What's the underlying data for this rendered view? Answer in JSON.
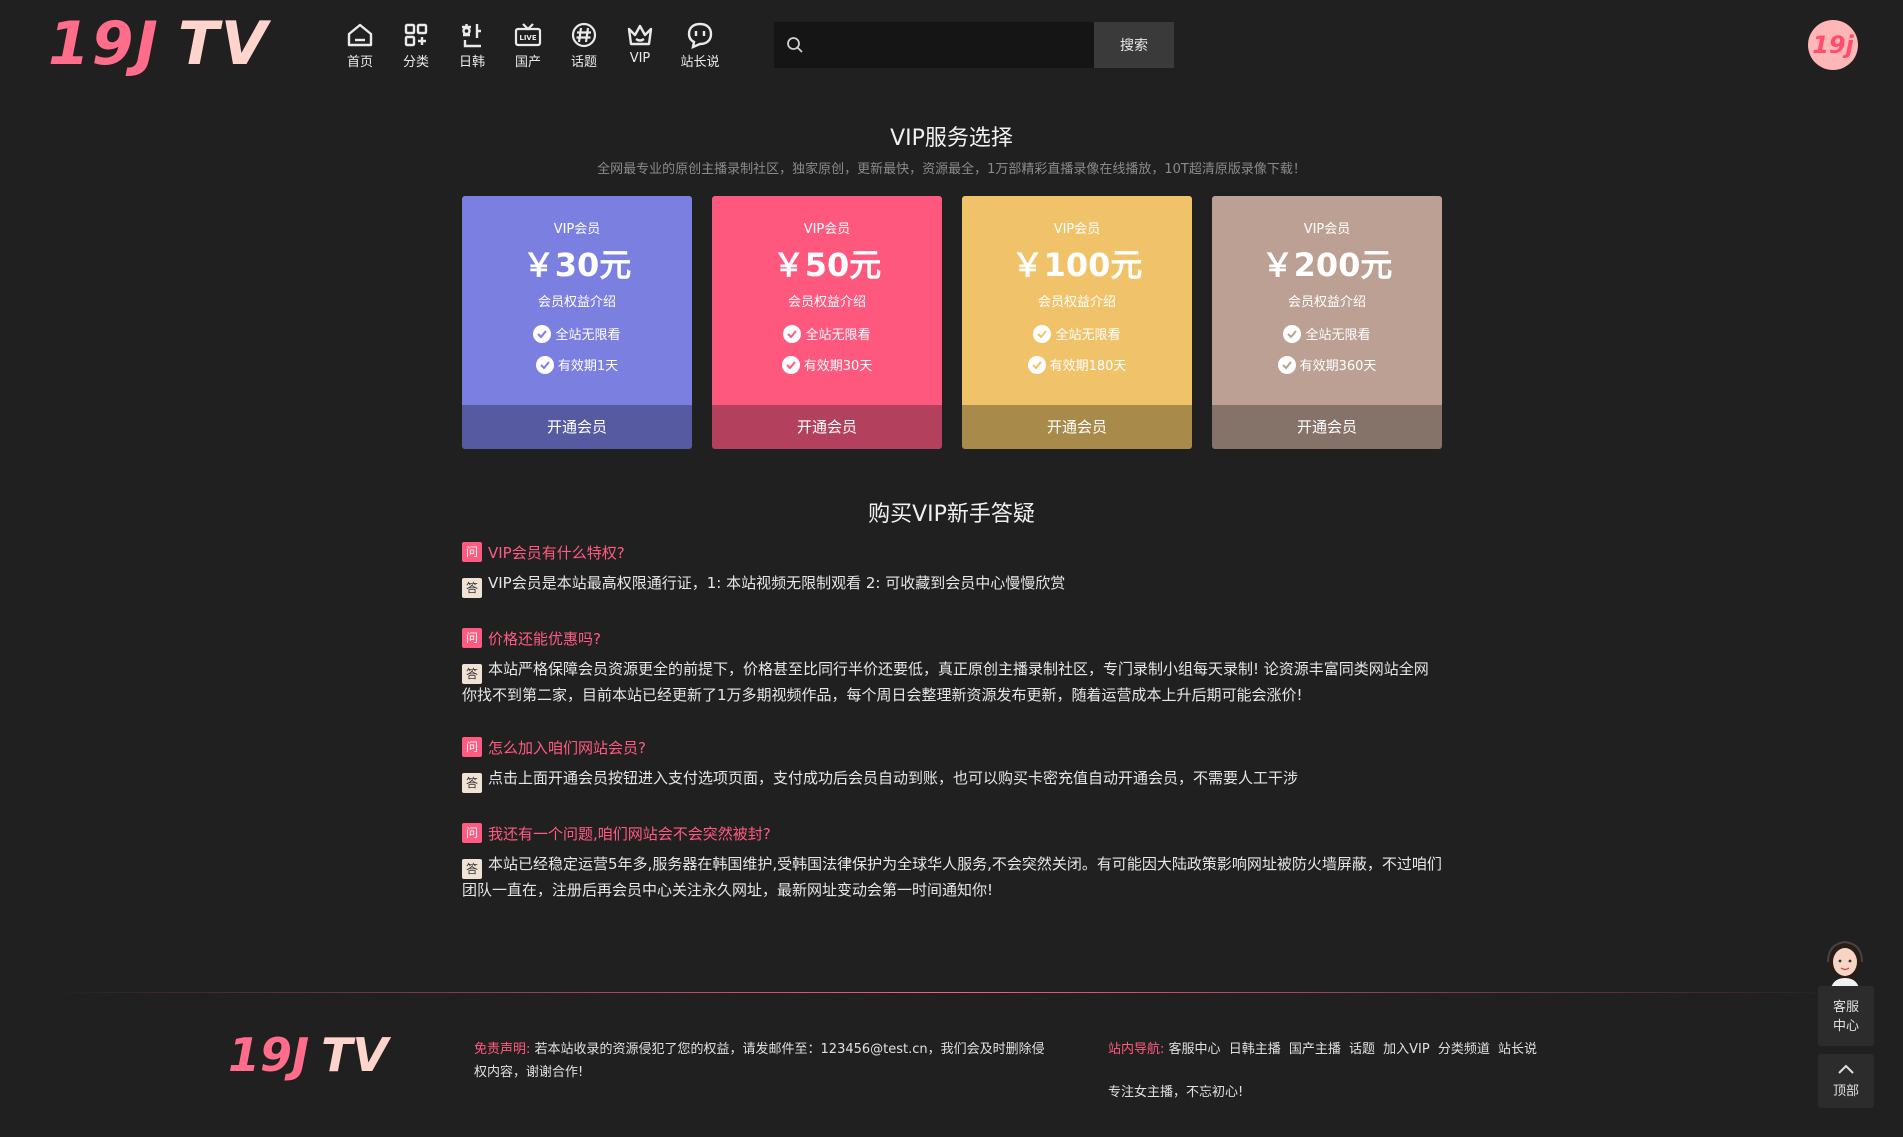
{
  "header": {
    "logo_num": "19J",
    "logo_tv": "TV",
    "nav": [
      {
        "label": "首页",
        "icon": "home-icon"
      },
      {
        "label": "分类",
        "icon": "category-icon"
      },
      {
        "label": "日韩",
        "icon": "korean-char-icon"
      },
      {
        "label": "国产",
        "icon": "live-tv-icon"
      },
      {
        "label": "话题",
        "icon": "hashtag-icon"
      },
      {
        "label": "VIP",
        "icon": "crown-icon"
      },
      {
        "label": "站长说",
        "icon": "chat-bubble-icon"
      }
    ],
    "search_placeholder": "",
    "search_button": "搜索",
    "avatar_text": "19j"
  },
  "vip": {
    "title": "VIP服务选择",
    "subtitle": "全网最专业的原创主播录制社区，独家原创，更新最快，资源最全，1万部精彩直播录像在线播放，10T超清原版录像下载！",
    "cards": [
      {
        "label": "VIP会员",
        "price": "￥30元",
        "intro": "会员权益介绍",
        "feat1": "全站无限看",
        "feat2": "有效期1天",
        "button": "开通会员",
        "color": "#7b7fe0",
        "btn_color": "#565aa0"
      },
      {
        "label": "VIP会员",
        "price": "￥50元",
        "intro": "会员权益介绍",
        "feat1": "全站无限看",
        "feat2": "有效期30天",
        "button": "开通会员",
        "color": "#ff587e",
        "btn_color": "#b3415e"
      },
      {
        "label": "VIP会员",
        "price": "￥100元",
        "intro": "会员权益介绍",
        "feat1": "全站无限看",
        "feat2": "有效期180天",
        "button": "开通会员",
        "color": "#f0c36a",
        "btn_color": "#a88a4a"
      },
      {
        "label": "VIP会员",
        "price": "￥200元",
        "intro": "会员权益介绍",
        "feat1": "全站无限看",
        "feat2": "有效期360天",
        "button": "开通会员",
        "color": "#bba093",
        "btn_color": "#857269"
      }
    ]
  },
  "faq": {
    "title": "购买VIP新手答疑",
    "q_badge": "问",
    "a_badge": "答",
    "items": [
      {
        "q": "VIP会员有什么特权?",
        "a": "VIP会员是本站最高权限通行证，1:   本站视频无限制观看 2: 可收藏到会员中心慢慢欣赏"
      },
      {
        "q": "价格还能优惠吗?",
        "a": "本站严格保障会员资源更全的前提下，价格甚至比同行半价还要低，真正原创主播录制社区，专门录制小组每天录制! 论资源丰富同类网站全网你找不到第二家，目前本站已经更新了1万多期视频作品，每个周日会整理新资源发布更新，随着运营成本上升后期可能会涨价!"
      },
      {
        "q": "怎么加入咱们网站会员?",
        "a": "点击上面开通会员按钮进入支付选项页面，支付成功后会员自动到账，也可以购买卡密充值自动开通会员，不需要人工干涉"
      },
      {
        "q": "我还有一个问题,咱们网站会不会突然被封?",
        "a": "本站已经稳定运营5年多,服务器在韩国维护,受韩国法律保护为全球华人服务,不会突然关闭。有可能因大陆政策影响网址被防火墙屏蔽，不过咱们团队一直在，注册后再会员中心关注永久网址，最新网址变动会第一时间通知你!"
      }
    ]
  },
  "footer": {
    "logo_num": "19J",
    "logo_tv": "TV",
    "disclaimer_label": "免责声明:",
    "disclaimer_text": " 若本站收录的资源侵犯了您的权益，请发邮件至：123456@test.cn，我们会及时删除侵权内容，谢谢合作!",
    "nav_label": "站内导航:",
    "nav_links": [
      "客服中心",
      "日韩主播",
      "国产主播",
      "话题",
      "加入VIP",
      "分类频道",
      "站长说"
    ],
    "slogan": "专注女主播，不忘初心!"
  },
  "widgets": {
    "kefu_line1": "客服",
    "kefu_line2": "中心",
    "top_label": "顶部"
  }
}
